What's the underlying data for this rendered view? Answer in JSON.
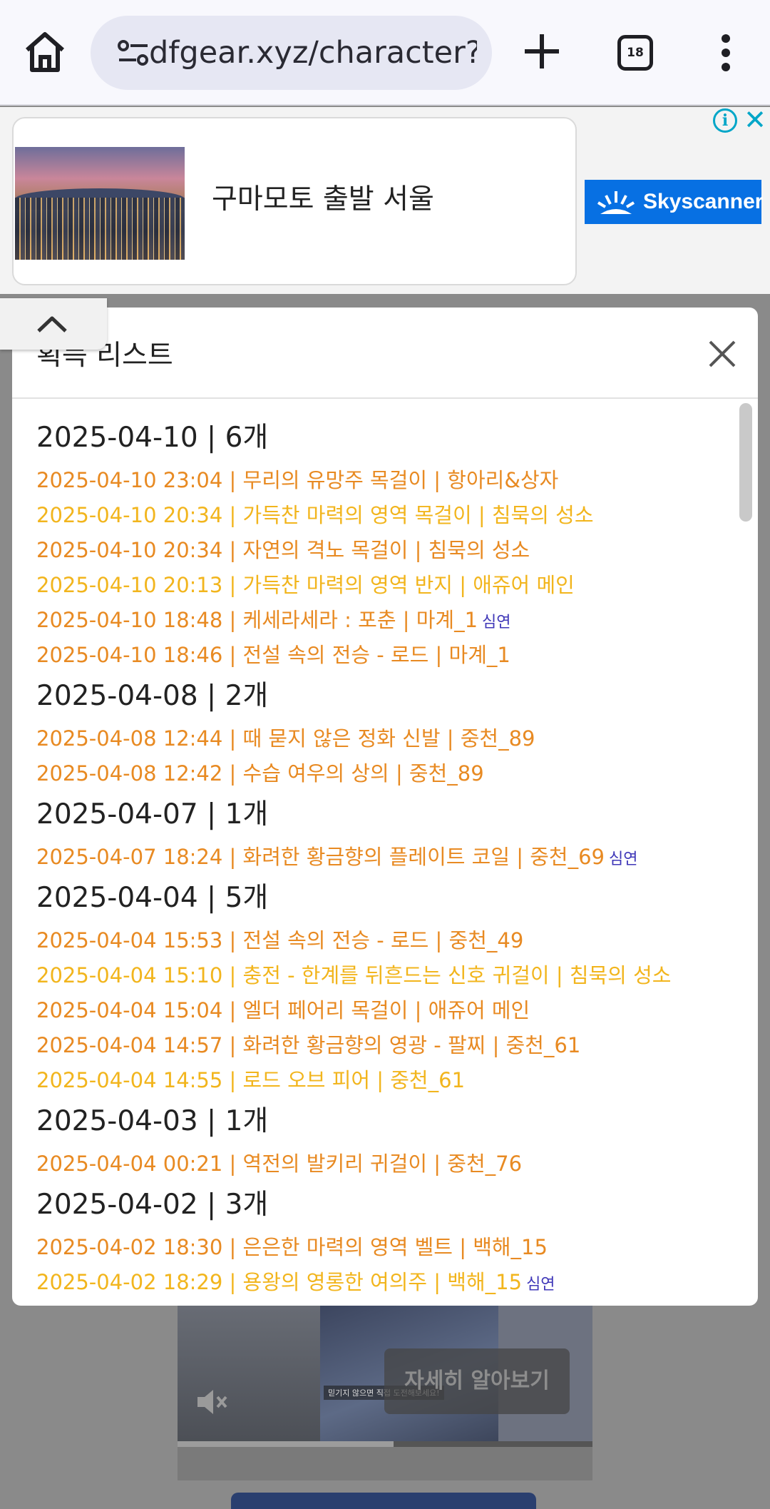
{
  "browser": {
    "url": "dfgear.xyz/character?slc",
    "tab_count": "18"
  },
  "ad": {
    "title": "구마모토 출발 서울",
    "brand": "Skyscanner",
    "info_icon": "info-icon",
    "close_icon": "close-icon"
  },
  "background": {
    "video_cta": "자세히 알아보기",
    "video_caption": "믿기지 않으면 직접 도전해보세요!",
    "video_progress": 0.52
  },
  "modal": {
    "title": "획득 리스트",
    "groups": [
      {
        "head": "2025-04-10 | 6개",
        "items": [
          {
            "text": "2025-04-10 23:04 | 무리의 유망주 목걸이 | 항아리&상자",
            "color": "orange",
            "tag": ""
          },
          {
            "text": "2025-04-10 20:34 | 가득찬 마력의 영역 목걸이 | 침묵의 성소",
            "color": "gold",
            "tag": ""
          },
          {
            "text": "2025-04-10 20:34 | 자연의 격노 목걸이 | 침묵의 성소",
            "color": "orange",
            "tag": ""
          },
          {
            "text": "2025-04-10 20:13 | 가득찬 마력의 영역 반지 | 애쥬어 메인",
            "color": "gold",
            "tag": ""
          },
          {
            "text": "2025-04-10 18:48 | 케세라세라 : 포춘 | 마계_1",
            "color": "orange",
            "tag": "심연"
          },
          {
            "text": "2025-04-10 18:46 | 전설 속의 전승 - 로드 | 마계_1",
            "color": "orange",
            "tag": ""
          }
        ]
      },
      {
        "head": "2025-04-08 | 2개",
        "items": [
          {
            "text": "2025-04-08 12:44 | 때 묻지 않은 정화 신발 | 중천_89",
            "color": "orange",
            "tag": ""
          },
          {
            "text": "2025-04-08 12:42 | 수습 여우의 상의 | 중천_89",
            "color": "orange",
            "tag": ""
          }
        ]
      },
      {
        "head": "2025-04-07 | 1개",
        "items": [
          {
            "text": "2025-04-07 18:24 | 화려한 황금향의 플레이트 코일 | 중천_69",
            "color": "orange",
            "tag": "심연"
          }
        ]
      },
      {
        "head": "2025-04-04 | 5개",
        "items": [
          {
            "text": "2025-04-04 15:53 | 전설 속의 전승 - 로드 | 중천_49",
            "color": "orange",
            "tag": ""
          },
          {
            "text": "2025-04-04 15:10 | 충전 - 한계를 뒤흔드는 신호 귀걸이 | 침묵의 성소",
            "color": "gold",
            "tag": ""
          },
          {
            "text": "2025-04-04 15:04 | 엘더 페어리 목걸이 | 애쥬어 메인",
            "color": "orange",
            "tag": ""
          },
          {
            "text": "2025-04-04 14:57 | 화려한 황금향의 영광 - 팔찌 | 중천_61",
            "color": "orange",
            "tag": ""
          },
          {
            "text": "2025-04-04 14:55 | 로드 오브 피어 | 중천_61",
            "color": "gold",
            "tag": ""
          }
        ]
      },
      {
        "head": "2025-04-03 | 1개",
        "items": [
          {
            "text": "2025-04-04 00:21 | 역전의 발키리 귀걸이 | 중천_76",
            "color": "orange",
            "tag": ""
          }
        ]
      },
      {
        "head": "2025-04-02 | 3개",
        "items": [
          {
            "text": "2025-04-02 18:30 | 은은한 마력의 영역 벨트 | 백해_15",
            "color": "orange",
            "tag": ""
          },
          {
            "text": "2025-04-02 18:29 | 용왕의 영롱한 여의주 | 백해_15",
            "color": "gold",
            "tag": "심연"
          }
        ]
      }
    ]
  }
}
